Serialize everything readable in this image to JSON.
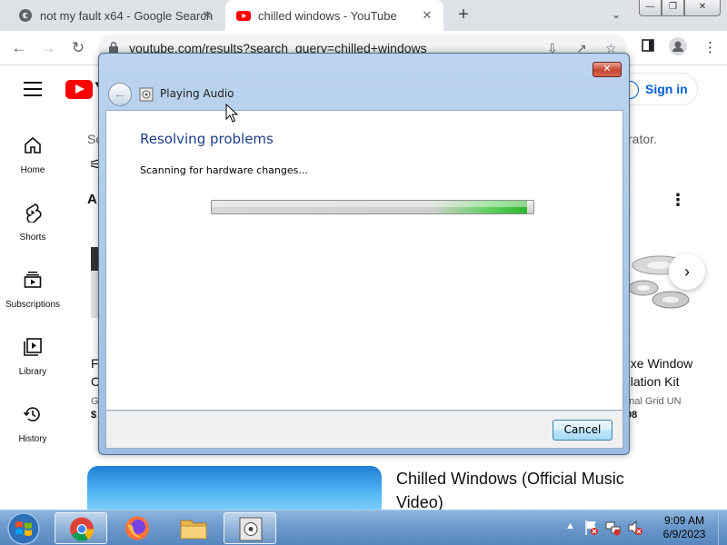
{
  "browser": {
    "tabs": [
      {
        "title": "not my fault x64 - Google Search",
        "active": false,
        "icon": "google-icon"
      },
      {
        "title": "chilled windows - YouTube",
        "active": true,
        "icon": "youtube-icon"
      }
    ],
    "new_tab": "+",
    "url": "youtube.com/results?search_query=chilled+windows",
    "colors": {
      "tabstrip": "#dee1e6",
      "active_tab": "#ffffff",
      "omnibox": "#f1f3f4"
    }
  },
  "youtube": {
    "sign_in": "Sign in",
    "sidebar": [
      {
        "label": "Home",
        "icon": "home-icon"
      },
      {
        "label": "Shorts",
        "icon": "shorts-icon"
      },
      {
        "label": "Subscriptions",
        "icon": "subscriptions-icon"
      },
      {
        "label": "Library",
        "icon": "library-icon"
      },
      {
        "label": "History",
        "icon": "history-icon"
      }
    ],
    "partial_texts": {
      "search_frag": "So",
      "banner_frag": "rator.",
      "a_frag": "A",
      "f_frag": "F",
      "c_frag": "C",
      "g_frag": "G",
      "dollar_frag": "$",
      "product_line1": "uxe Window",
      "product_line2": "ulation Kit",
      "product_seller": "onal Grid UN",
      "product_price": ".98"
    },
    "video": {
      "title": "Chilled Windows (Official Music Video)"
    },
    "brand_color": "#ff0000",
    "link_color": "#065fd4"
  },
  "dialog": {
    "title": "Playing Audio",
    "heading": "Resolving problems",
    "status": "Scanning for hardware changes...",
    "progress": 0.98,
    "cancel_label": "Cancel",
    "close_glyph": "✕"
  },
  "taskbar": {
    "apps": [
      "chrome-icon",
      "firefox-icon",
      "explorer-icon",
      "troubleshooter-icon"
    ],
    "time": "9:09 AM",
    "date": "6/9/2023",
    "tray_arrow": "▲"
  }
}
